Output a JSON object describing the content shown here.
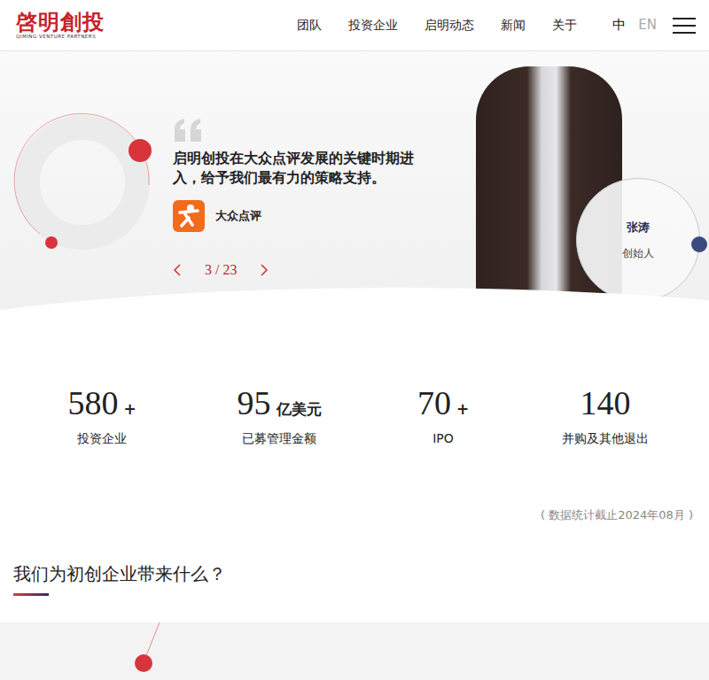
{
  "header": {
    "logo": {
      "title": "啓明創投",
      "subtitle": "QIMING VENTURE PARTNERS"
    },
    "nav": [
      "团队",
      "投资企业",
      "启明动态",
      "新闻",
      "关于"
    ],
    "languages": [
      {
        "label": "中",
        "selected": true
      },
      {
        "label": "EN",
        "selected": false
      }
    ]
  },
  "testimonial": {
    "quote": "启明创投在大众点评发展的关键时期进入，给予我们最有力的策略支持。",
    "company": "大众点评",
    "pagination": "3 / 23",
    "person": {
      "name": "张涛",
      "role": "创始人"
    }
  },
  "stats": [
    {
      "value": "580",
      "suffix": "+",
      "label": "投资企业"
    },
    {
      "value": "95",
      "suffix": "亿美元",
      "label": "已募管理金额"
    },
    {
      "value": "70",
      "suffix": "+",
      "label": "IPO"
    },
    {
      "value": "140",
      "suffix": "",
      "label": "并购及其他退出"
    }
  ],
  "stats_note": "( 数据统计截止2024年08月 )",
  "section_title": "我们为初创企业带来什么？"
}
